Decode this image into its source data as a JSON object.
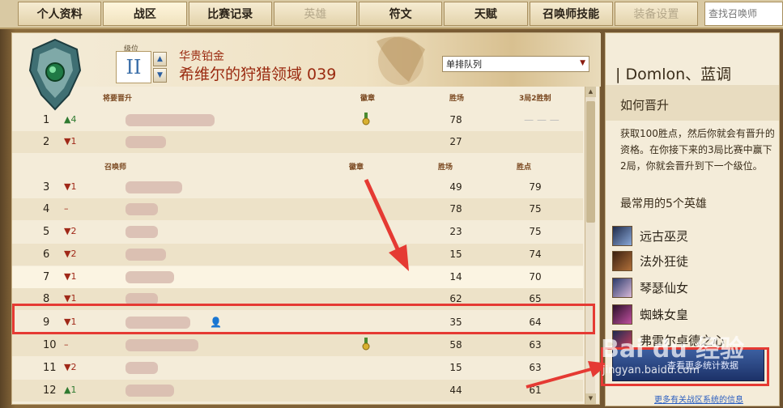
{
  "nav": {
    "tabs": [
      {
        "label": "个人资料",
        "state": "normal"
      },
      {
        "label": "战区",
        "state": "active"
      },
      {
        "label": "比赛记录",
        "state": "normal"
      },
      {
        "label": "英雄",
        "state": "disabled"
      },
      {
        "label": "符文",
        "state": "normal"
      },
      {
        "label": "天赋",
        "state": "normal"
      },
      {
        "label": "召唤师技能",
        "state": "normal"
      },
      {
        "label": "装备设置",
        "state": "disabled"
      }
    ],
    "search_placeholder": "查找召唤师"
  },
  "league": {
    "tier_label": "级位",
    "division": "II",
    "tier_name": "华贵铂金",
    "name": "希维尔的狩猎领域 039",
    "queue": "单排队列"
  },
  "promo_section": {
    "headers": {
      "title": "将要晋升",
      "badge": "徽章",
      "wins": "胜场",
      "series": "3局2胜制"
    },
    "series_marks": "— — —"
  },
  "main_section": {
    "headers": {
      "summoner": "召唤师",
      "badge": "徽章",
      "wins": "胜场",
      "points": "胜点"
    }
  },
  "rows": [
    {
      "rank": "1",
      "move": "▲4",
      "dir": "up",
      "wins": "78",
      "points": "",
      "badge": true
    },
    {
      "rank": "2",
      "move": "▼1",
      "dir": "down",
      "wins": "27",
      "points": "",
      "badge": false
    },
    {
      "rank": "3",
      "move": "▼1",
      "dir": "down",
      "wins": "49",
      "points": "79",
      "badge": false
    },
    {
      "rank": "4",
      "move": "–",
      "dir": "none",
      "wins": "78",
      "points": "75",
      "badge": false
    },
    {
      "rank": "5",
      "move": "▼2",
      "dir": "down",
      "wins": "23",
      "points": "75",
      "badge": false
    },
    {
      "rank": "6",
      "move": "▼2",
      "dir": "down",
      "wins": "15",
      "points": "74",
      "badge": false
    },
    {
      "rank": "7",
      "move": "▼1",
      "dir": "down",
      "wins": "14",
      "points": "70",
      "badge": false
    },
    {
      "rank": "8",
      "move": "▼1",
      "dir": "down",
      "wins": "62",
      "points": "65",
      "badge": false
    },
    {
      "rank": "9",
      "move": "▼1",
      "dir": "down",
      "wins": "35",
      "points": "64",
      "badge": false
    },
    {
      "rank": "10",
      "move": "–",
      "dir": "none",
      "wins": "58",
      "points": "63",
      "badge": true
    },
    {
      "rank": "11",
      "move": "▼2",
      "dir": "down",
      "wins": "15",
      "points": "63",
      "badge": false
    },
    {
      "rank": "12",
      "move": "▲1",
      "dir": "up",
      "wins": "44",
      "points": "61",
      "badge": false
    }
  ],
  "sidebar": {
    "summoner_name": "| Domlon、蓝调",
    "howto_title": "如何晋升",
    "howto_desc": "获取100胜点，然后你就会有晋升的资格。在你接下来的3局比赛中赢下2局，你就会晋升到下一个级位。",
    "most_played_title": "最常用的5个英雄",
    "champions": [
      "远古巫灵",
      "法外狂徒",
      "琴瑟仙女",
      "蜘蛛女皇",
      "弗雷尔卓德之心"
    ],
    "stats_button": "查看更多统计数据",
    "more_link": "更多有关战区系统的信息"
  },
  "colors": {
    "highlight_box": "#e53a33",
    "arrow": "#e53a33",
    "link": "#2a5ec0",
    "loss": "#a02818",
    "gain": "#2f7a30"
  },
  "watermark": {
    "logo": "Bai du 经验",
    "url": "jingyan.baidu.com"
  }
}
